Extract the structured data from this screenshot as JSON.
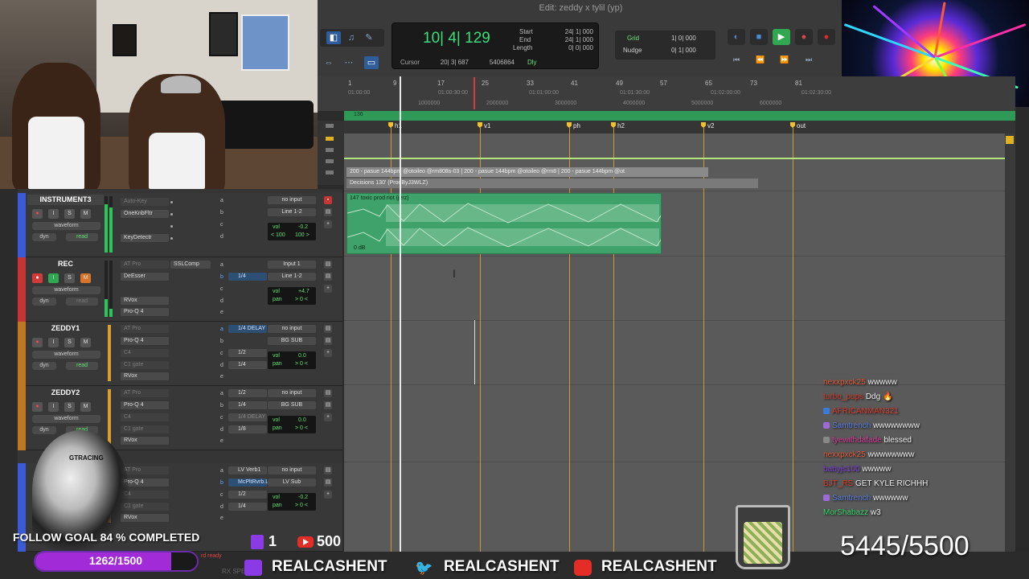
{
  "window": {
    "title": "Edit: zeddy x tylil (yp)"
  },
  "counter": {
    "main": "10| 4| 129",
    "start_label": "Start",
    "start_value": "24| 1| 000",
    "end_label": "End",
    "end_value": "24| 1| 000",
    "length_label": "Length",
    "length_value": "0| 0| 000",
    "cursor_label": "Cursor",
    "cursor_value": "20| 3| 687",
    "samples": "5406864",
    "dly_label": "Dly"
  },
  "grid": {
    "grid_label": "Grid",
    "grid_value": "1| 0| 000",
    "nudge_label": "Nudge",
    "nudge_value": "0| 1| 000"
  },
  "ruler": {
    "bars": [
      "1",
      "9",
      "17",
      "25",
      "33",
      "41",
      "49",
      "57",
      "65",
      "73",
      "81"
    ],
    "times": [
      "01:00:00",
      "01:00:30:00",
      "01:01:00:00",
      "01:01:30:00",
      "01:02:00:00",
      "01:02:30:00"
    ],
    "samples": [
      "1000000",
      "2000000",
      "3000000",
      "4000000",
      "5000000",
      "6000000"
    ],
    "tempo": "136"
  },
  "markers": [
    "h1",
    "v1",
    "ph",
    "h2",
    "v2",
    "out"
  ],
  "clips": {
    "beat_row": "200 - pasue 144bpm @otoileo @rm808s-03 | 200 - pasue 144bpm @otoileo @rm8 | 200 - pasue 144bpm @ot",
    "decisions": "Decisions 130' (ProdByJ3WLZ)",
    "audio_name": "147 toxic prod riot (jerz)",
    "audio_db": "0 dB"
  },
  "tracks": [
    {
      "name": "INSTRUMENT3",
      "color": "#3b5bd6",
      "view": "waveform",
      "dyn": "dyn",
      "dyn2": "read",
      "inserts": [
        "Auto-Key",
        "OneKnbFltr",
        "",
        "KeyDetectr",
        ""
      ],
      "sends": [
        "a",
        "b",
        "c",
        "d",
        "e"
      ],
      "send_values": [
        "",
        "",
        "",
        "",
        ""
      ],
      "input": "no input",
      "output": "Line 1-2",
      "vol_label": "vol",
      "vol": "-0.2",
      "pan_l": "< 100",
      "pan_r": "100 >"
    },
    {
      "name": "REC",
      "color": "#c73434",
      "view": "waveform",
      "dyn": "dyn",
      "dyn2": "read",
      "inserts": [
        "AT Pro",
        "DeEsser",
        "",
        "RVox",
        "Pro-Q 4"
      ],
      "inserts2": "SSLComp",
      "sends": [
        "a",
        "b",
        "c",
        "d",
        "e"
      ],
      "send_values": [
        "",
        "1/4",
        "",
        "",
        ""
      ],
      "input": "Input 1",
      "output": "Line 1-2",
      "vol_label": "vol",
      "vol": "+4.7",
      "pan_label": "pan",
      "pan": "> 0 <"
    },
    {
      "name": "ZEDDY1",
      "color": "#c07820",
      "view": "waveform",
      "dyn": "dyn",
      "dyn2": "read",
      "inserts": [
        "AT Pro",
        "Pro-Q 4",
        "C4",
        "C1 gate",
        "RVox"
      ],
      "sends": [
        "a",
        "b",
        "c",
        "d",
        "e"
      ],
      "send_values": [
        "1/4 DELAY",
        "",
        "1/2",
        "1/4",
        ""
      ],
      "input": "no input",
      "output": "BG SUB",
      "vol_label": "vol",
      "vol": "0.0",
      "pan_label": "pan",
      "pan": "> 0 <"
    },
    {
      "name": "ZEDDY2",
      "color": "#c07820",
      "view": "waveform",
      "dyn": "dyn",
      "dyn2": "read",
      "inserts": [
        "AT Pro",
        "Pro-Q 4",
        "C4",
        "C1 gate",
        "RVox"
      ],
      "sends": [
        "a",
        "b",
        "c",
        "d",
        "e"
      ],
      "send_values": [
        "1/2",
        "1/4",
        "1/4 DELAY",
        "1/8",
        ""
      ],
      "input": "no input",
      "output": "BG SUB",
      "vol_label": "vol",
      "vol": "0.0",
      "pan_label": "pan",
      "pan": "> 0 <"
    },
    {
      "name": "",
      "color": "#3b5bd6",
      "view": "",
      "dyn": "",
      "dyn2": "",
      "inserts": [
        "AT Pro",
        "Pro-Q 4",
        "C4",
        "C1 gate",
        "RVox"
      ],
      "sends": [
        "a",
        "b",
        "c",
        "d",
        "e"
      ],
      "send_values": [
        "LV Verb1",
        "McPltRvrb.L",
        "1/2",
        "1/4",
        ""
      ],
      "input": "no input",
      "output": "LV Sub",
      "vol_label": "vol",
      "vol": "-0.2",
      "pan_label": "pan",
      "pan": "> 0 <"
    }
  ],
  "overlay": {
    "follow_goal": "FOLLOW GOAL 84 % COMPLETED",
    "goal_count": "1262/1500",
    "goal_progress": 0.8413,
    "chair_brand": "GTRACING",
    "twitch_count": "1",
    "yt_count": "500",
    "social_handle": "REALCASHENT",
    "sub_goal": "5445/5500",
    "status": "rd ready",
    "rx_text": "RX SPE"
  },
  "chat": [
    {
      "user": "nexxpxck25",
      "msg": "wwwww",
      "color": "#e05a3a",
      "badge": ""
    },
    {
      "user": "turbo_pups",
      "msg": "Ddg 🔥",
      "color": "#d83a2a",
      "badge": ""
    },
    {
      "user": "AFRICANMAN321",
      "msg": "",
      "color": "#d83a2a",
      "badge": "#3a7bd6"
    },
    {
      "user": "Samtrench",
      "msg": "wwwwwwww",
      "color": "#5b7fe0",
      "badge": "#9b6bd6"
    },
    {
      "user": "tyewithdafade",
      "msg": "blessed",
      "color": "#d63a9a",
      "badge": "#888"
    },
    {
      "user": "nexxpxck25",
      "msg": "wwwwwwww",
      "color": "#e05a3a",
      "badge": ""
    },
    {
      "user": "babyjs100",
      "msg": "wwwww",
      "color": "#7a3ad6",
      "badge": ""
    },
    {
      "user": "BJT_RS",
      "msg": "GET KYLE RICHHH",
      "color": "#d83a2a",
      "badge": ""
    },
    {
      "user": "Samtrench",
      "msg": "wwwwww",
      "color": "#5b7fe0",
      "badge": "#9b6bd6"
    },
    {
      "user": "MorShabazz",
      "msg": "w3",
      "color": "#3ad66b",
      "badge": ""
    }
  ],
  "colors": {
    "accent_green": "#39e07a",
    "clip_green": "#3fa26a",
    "locator": "#c79a2b",
    "goal_purple": "#a12bd6"
  }
}
